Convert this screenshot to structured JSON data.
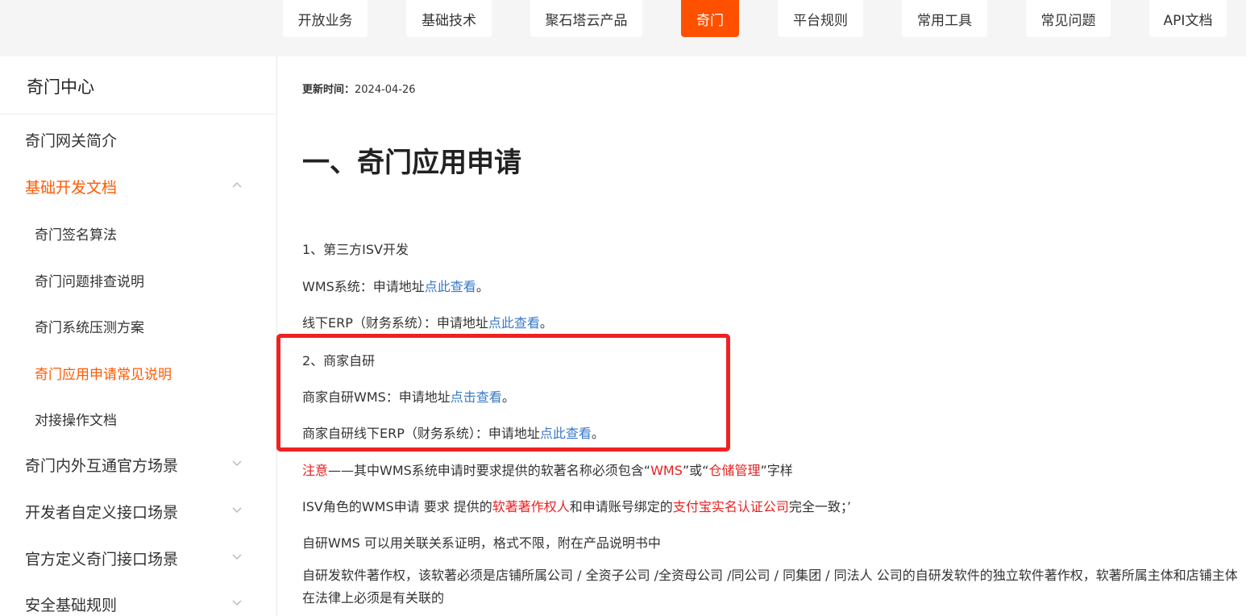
{
  "topnav": [
    {
      "label": "开放业务",
      "active": false
    },
    {
      "label": "基础技术",
      "active": false
    },
    {
      "label": "聚石塔云产品",
      "active": false
    },
    {
      "label": "奇门",
      "active": true
    },
    {
      "label": "平台规则",
      "active": false
    },
    {
      "label": "常用工具",
      "active": false
    },
    {
      "label": "常见问题",
      "active": false
    },
    {
      "label": "API文档",
      "active": false
    }
  ],
  "sidebar": {
    "title": "奇门中心",
    "items": [
      {
        "label": "奇门网关简介"
      },
      {
        "label": "基础开发文档",
        "expanded": true
      },
      {
        "label": "奇门签名算法"
      },
      {
        "label": "奇门问题排查说明"
      },
      {
        "label": "奇门系统压测方案"
      },
      {
        "label": "奇门应用申请常见说明",
        "selected": true
      },
      {
        "label": "对接操作文档"
      },
      {
        "label": "奇门内外互通官方场景",
        "expanded": false
      },
      {
        "label": "开发者自定义接口场景",
        "expanded": false
      },
      {
        "label": "官方定义奇门接口场景",
        "expanded": false
      },
      {
        "label": "安全基础规则",
        "expanded": false
      }
    ]
  },
  "article": {
    "update_label": "更新时间：",
    "update_date": "2024-04-26",
    "heading": "一、奇门应用申请",
    "s1": "1、第三方ISV开发",
    "wms_prefix": "WMS系统：申请地址",
    "wms_link": "点此查看",
    "erp_prefix": "线下ERP（财务系统）：申请地址",
    "erp_link": "点此查看",
    "s2": "2、商家自研",
    "self_wms_prefix": "商家自研WMS：申请地址",
    "self_wms_link": "点击查看",
    "self_erp_prefix": "商家自研线下ERP（财务系统）：申请地址",
    "self_erp_link": "点此查看",
    "period": "。",
    "note_label": "注意",
    "note_text_1": "——其中WMS系统申请时要求提供的软著名称必须包含“",
    "note_wms": "WMS",
    "note_text_2": "”或“",
    "note_store": "仓储管理",
    "note_text_3": "”字样",
    "isv_text_1": "ISV角色的WMS申请 要求 提供的",
    "isv_owner": "软著著作权人",
    "isv_text_2": "和申请账号绑定的",
    "isv_company": "支付宝实名认证公司",
    "isv_text_3": "完全一致；’",
    "selfwms_line": "自研WMS 可以用关联关系证明，格式不限，附在产品说明书中",
    "selfdev_line1": "自研发软件著作权，该软著必须是店铺所属公司 / 全资子公司 /全资母公司 /同公司 / 同集团 / 同法人 公司的自研发软件的独立软件著作权，软著所属主体和店铺主体",
    "selfdev_line2": "在法律上必须是有关联的"
  },
  "colors": {
    "accent": "#ff5000",
    "link": "#3a78c9",
    "warning": "#e62222",
    "highlight": "#ee2222"
  }
}
